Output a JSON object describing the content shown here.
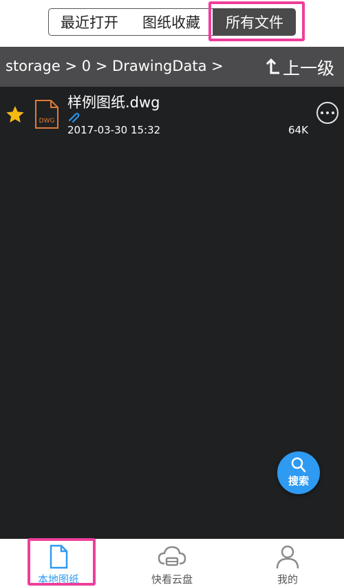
{
  "tabs": [
    {
      "label": "最近打开",
      "active": false
    },
    {
      "label": "图纸收藏",
      "active": false
    },
    {
      "label": "所有文件",
      "active": true
    }
  ],
  "path_bar": {
    "path": "storage > 0 > DrawingData >",
    "up_label": "上一级"
  },
  "files": [
    {
      "name": "样例图纸.dwg",
      "type_badge": "DWG",
      "date": "2017-03-30 15:32",
      "size": "64K",
      "starred": true,
      "pinned": true
    }
  ],
  "search_fab": {
    "label": "搜索"
  },
  "bottom_nav": [
    {
      "label": "本地图纸",
      "icon": "document-icon",
      "active": true
    },
    {
      "label": "快看云盘",
      "icon": "cloud-drive-icon",
      "active": false
    },
    {
      "label": "我的",
      "icon": "person-icon",
      "active": false
    }
  ],
  "colors": {
    "background": "#1f2022",
    "path_bar": "#4b4b4d",
    "accent": "#2e9af2",
    "highlight": "#ee3f9b",
    "star": "#f5b914",
    "file_icon": "#e07b39"
  }
}
